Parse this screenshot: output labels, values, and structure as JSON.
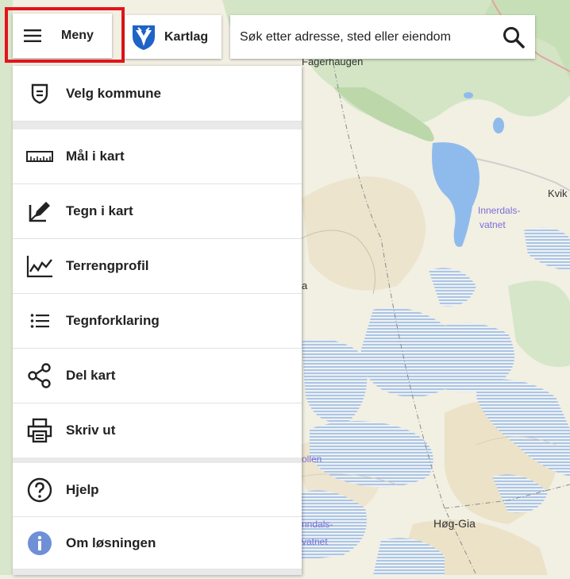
{
  "toolbar": {
    "menu_label": "Meny",
    "layers_label": "Kartlag",
    "search_placeholder": "Søk etter adresse, sted eller eiendom"
  },
  "menu": {
    "items": [
      {
        "label": "Velg kommune",
        "icon": "shield-icon"
      },
      {
        "label": "Mål i kart",
        "icon": "ruler-icon"
      },
      {
        "label": "Tegn i kart",
        "icon": "draw-icon"
      },
      {
        "label": "Terrengprofil",
        "icon": "profile-chart-icon"
      },
      {
        "label": "Tegnforklaring",
        "icon": "list-icon"
      },
      {
        "label": "Del kart",
        "icon": "share-icon"
      },
      {
        "label": "Skriv ut",
        "icon": "printer-icon"
      },
      {
        "label": "Hjelp",
        "icon": "help-icon"
      },
      {
        "label": "Om løsningen",
        "icon": "info-icon"
      }
    ]
  },
  "map": {
    "labels": {
      "fagerhaugen": "Fagerhaugen",
      "innerdalsvatnet_1": "Innerdals-",
      "innerdalsvatnet_2": "vatnet",
      "kvik": "Kvik",
      "ollen": "ollen",
      "inndals_1": "nndals-",
      "inndals_2": "vatnet",
      "hog_gia": "Høg-Gia",
      "a": "a"
    }
  },
  "colors": {
    "highlight": "#e3141a",
    "forest": "#cfe2c0",
    "water": "#8fb8ee",
    "info": "#6f8fd6"
  }
}
